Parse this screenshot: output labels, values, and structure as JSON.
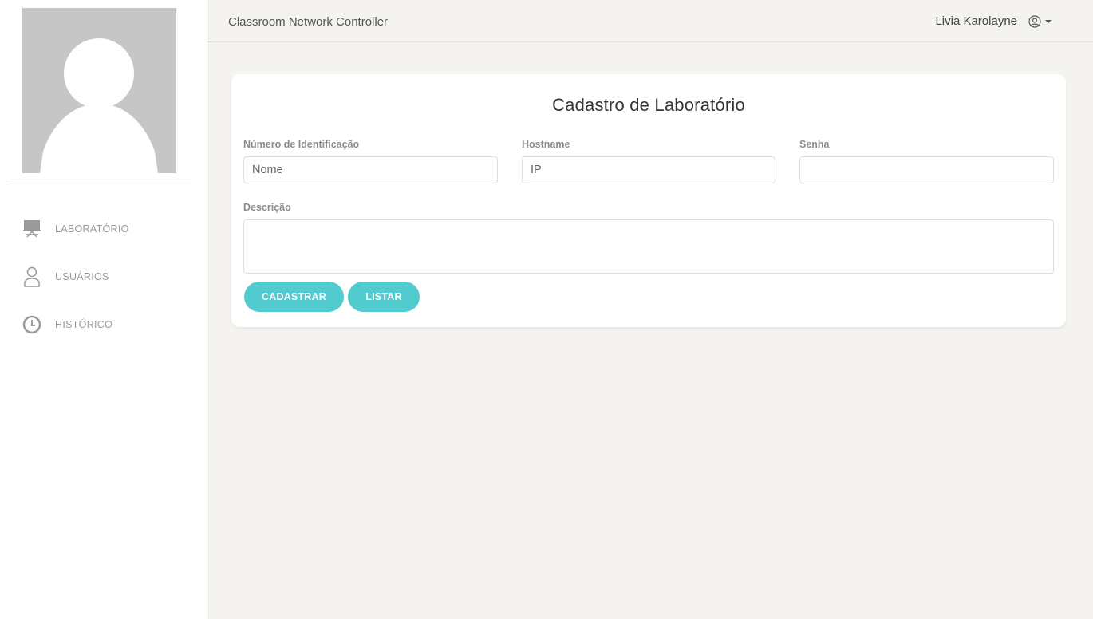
{
  "sidebar": {
    "items": [
      {
        "label": "LABORATÓRIO",
        "icon": "monitor-icon"
      },
      {
        "label": "USUÁRIOS",
        "icon": "user-icon"
      },
      {
        "label": "HISTÓRICO",
        "icon": "clock-icon"
      }
    ]
  },
  "topbar": {
    "brand": "Classroom Network Controller",
    "user_name": "Livia Karolayne",
    "user_icon": "user-circle-icon"
  },
  "form": {
    "title": "Cadastro de Laboratório",
    "id_label": "Número de Identificação",
    "id_placeholder": "Nome",
    "hostname_label": "Hostname",
    "hostname_placeholder": "IP",
    "password_label": "Senha",
    "password_placeholder": "",
    "description_label": "Descrição",
    "description_placeholder": "",
    "submit_label": "CADASTRAR",
    "list_label": "LISTAR"
  },
  "colors": {
    "accent": "#51cbce",
    "background": "#f4f3ef",
    "avatar": "#c6c6c6"
  }
}
